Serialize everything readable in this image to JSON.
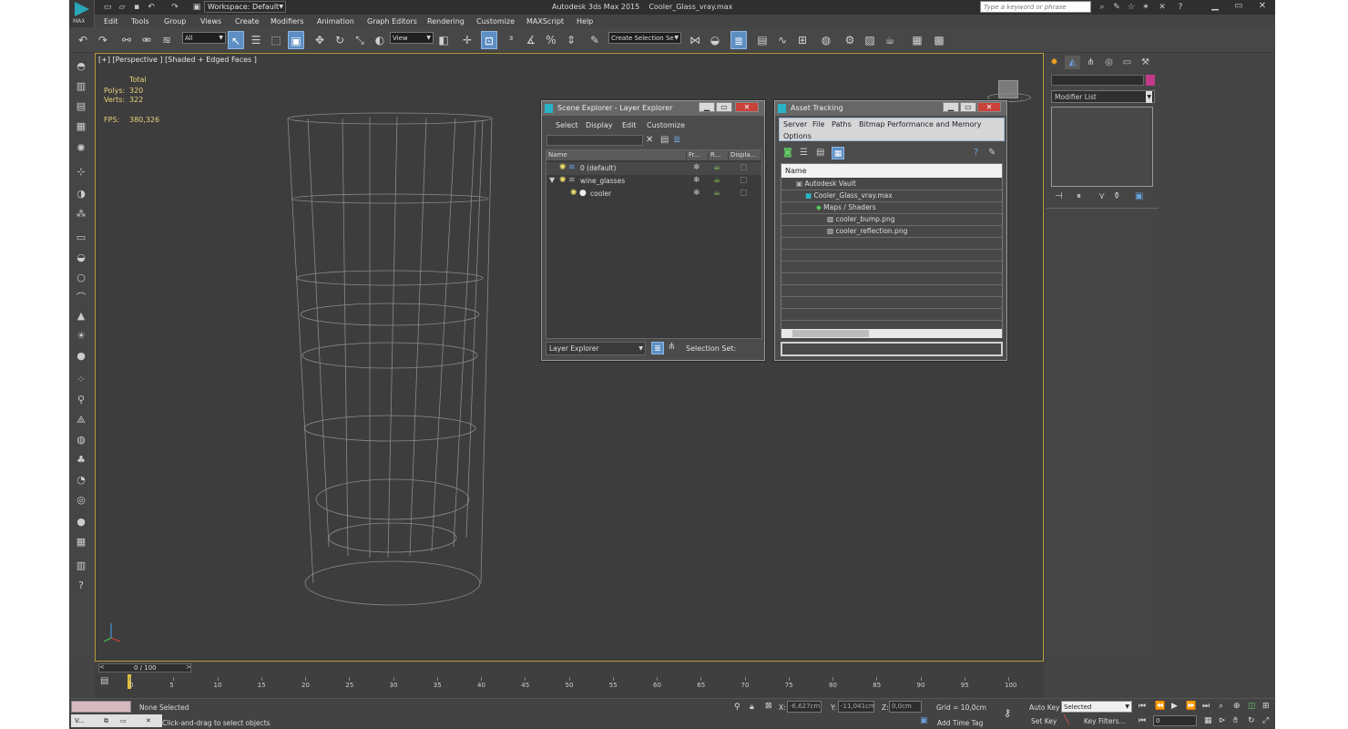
{
  "titlebar": {
    "workspace": "Workspace: Default",
    "app_title": "Autodesk 3ds Max 2015",
    "file_title": "Cooler_Glass_vray.max",
    "search_placeholder": "Type a keyword or phrase",
    "logo_text": "MAX"
  },
  "menu": [
    "Edit",
    "Tools",
    "Group",
    "Views",
    "Create",
    "Modifiers",
    "Animation",
    "Graph Editors",
    "Rendering",
    "Customize",
    "MAXScript",
    "Help"
  ],
  "toolbar": {
    "filter_value": "All",
    "ref_coord_value": "View",
    "selection_set_placeholder": "Create Selection Se"
  },
  "viewport": {
    "label": "[+] [Perspective ] [Shaded + Edged Faces ]",
    "stats": {
      "total_label": "Total",
      "polys_label": "Polys:",
      "polys_value": "320",
      "verts_label": "Verts:",
      "verts_value": "322",
      "fps_label": "FPS:",
      "fps_value": "380,326"
    }
  },
  "scene_explorer": {
    "title": "Scene Explorer - Layer Explorer",
    "menu": [
      "Select",
      "Display",
      "Edit",
      "Customize"
    ],
    "columns": [
      "Name",
      "Fr...",
      "R...",
      "Displa..."
    ],
    "rows": [
      {
        "name": "0 (default)",
        "indent": 0
      },
      {
        "name": "wine_glasses",
        "indent": 0
      },
      {
        "name": "cooler",
        "indent": 1
      }
    ],
    "footer_mode": "Layer Explorer",
    "selection_set_label": "Selection Set:"
  },
  "asset_tracking": {
    "title": "Asset Tracking",
    "menu": [
      "Server",
      "File",
      "Paths",
      "Bitmap Performance and Memory"
    ],
    "menu2": [
      "Options"
    ],
    "column": "Name",
    "rows": [
      {
        "name": "Autodesk Vault",
        "level": 0
      },
      {
        "name": "Cooler_Glass_vray.max",
        "level": 1
      },
      {
        "name": "Maps / Shaders",
        "level": 2
      },
      {
        "name": "cooler_bump.png",
        "level": 3
      },
      {
        "name": "cooler_reflection.png",
        "level": 3
      }
    ]
  },
  "command_panel": {
    "modifier_list": "Modifier List"
  },
  "timeline": {
    "frame_counter": "0 / 100",
    "ticks": [
      "0",
      "5",
      "10",
      "15",
      "20",
      "25",
      "30",
      "35",
      "40",
      "45",
      "50",
      "55",
      "60",
      "65",
      "70",
      "75",
      "80",
      "85",
      "90",
      "95",
      "100"
    ]
  },
  "statusbar": {
    "selection_status": "None Selected",
    "prompt": "Click-and-drag to select objects",
    "x_label": "X:",
    "x_value": "-6,627cm",
    "y_label": "Y:",
    "y_value": "-11,041cm",
    "z_label": "Z:",
    "z_value": "0,0cm",
    "grid": "Grid = 10,0cm",
    "add_time_tag": "Add Time Tag",
    "auto_key": "Auto Key",
    "set_key": "Set Key",
    "selected_value": "Selected",
    "key_filters": "Key Filters...",
    "frame_value": "0",
    "taskbar_label": "V..."
  },
  "colors": {
    "accent": "#5d8fc4",
    "viewport_border": "#b59a3a",
    "stats_text": "#e6d27a",
    "close_button": "#c8423a",
    "brand": "#2aa7b8"
  }
}
